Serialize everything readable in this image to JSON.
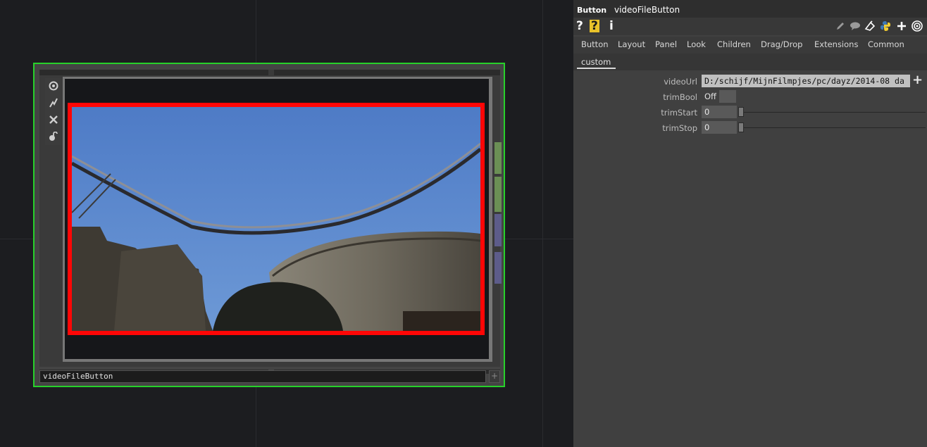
{
  "network": {
    "node": {
      "label": "videoFileButton",
      "sidebar_icons": [
        "viewer-active-icon",
        "bypass-icon",
        "close-icon",
        "lock-icon"
      ]
    }
  },
  "panel": {
    "op_type": "Button",
    "op_name": "videoFileButton",
    "toolbar": {
      "help": "?",
      "python_help": "?",
      "info": "i",
      "right_icons": [
        "pencil-icon",
        "comment-icon",
        "clone-icon",
        "python-icon",
        "add-icon",
        "target-icon"
      ]
    },
    "tabs": [
      "Button",
      "Layout",
      "Panel",
      "Look",
      "Children",
      "Drag/Drop",
      "Extensions",
      "Common"
    ],
    "subtab": "custom",
    "params": [
      {
        "label": "videoUrl",
        "value": "D:/schijf/MijnFilmpjes/pc/dayz/2014-08 da"
      },
      {
        "label": "trimBool",
        "value": "Off"
      },
      {
        "label": "trimStart",
        "value": "0"
      },
      {
        "label": "trimStop",
        "value": "0"
      }
    ],
    "add_param_symbol": "+"
  },
  "colors": {
    "selection_outline": "#27d12a",
    "video_border": "#ff0606",
    "panel_bg": "#404040"
  }
}
